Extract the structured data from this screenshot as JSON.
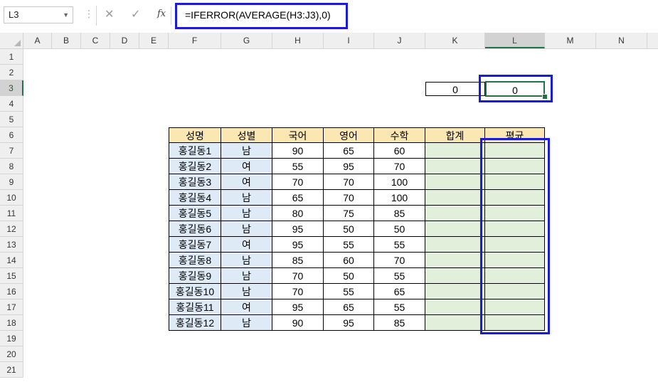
{
  "formula_bar": {
    "name_box": "L3",
    "cancel_glyph": "✕",
    "enter_glyph": "✓",
    "fx_label": "fx",
    "formula": "=IFERROR(AVERAGE(H3:J3),0)"
  },
  "columns": [
    "A",
    "B",
    "C",
    "D",
    "E",
    "F",
    "G",
    "H",
    "I",
    "J",
    "K",
    "L",
    "M",
    "N"
  ],
  "rows": [
    "1",
    "2",
    "3",
    "4",
    "5",
    "6",
    "7",
    "8",
    "9",
    "10",
    "11",
    "12",
    "13",
    "14",
    "15",
    "16",
    "17",
    "18",
    "19",
    "20",
    "21"
  ],
  "selected_cell": {
    "column": "L",
    "row": "3"
  },
  "summary_cells": {
    "k3": "0",
    "l3": "0"
  },
  "table": {
    "headers": [
      "성명",
      "성별",
      "국어",
      "영어",
      "수학",
      "합계",
      "평균"
    ],
    "rows": [
      [
        "홍길동1",
        "남",
        "90",
        "65",
        "60",
        "",
        ""
      ],
      [
        "홍길동2",
        "여",
        "55",
        "95",
        "70",
        "",
        ""
      ],
      [
        "홍길동3",
        "여",
        "70",
        "70",
        "100",
        "",
        ""
      ],
      [
        "홍길동4",
        "남",
        "65",
        "70",
        "100",
        "",
        ""
      ],
      [
        "홍길동5",
        "남",
        "80",
        "75",
        "85",
        "",
        ""
      ],
      [
        "홍길동6",
        "남",
        "95",
        "50",
        "50",
        "",
        ""
      ],
      [
        "홍길동7",
        "여",
        "95",
        "55",
        "55",
        "",
        ""
      ],
      [
        "홍길동8",
        "남",
        "85",
        "60",
        "70",
        "",
        ""
      ],
      [
        "홍길동9",
        "남",
        "70",
        "50",
        "55",
        "",
        ""
      ],
      [
        "홍길동10",
        "남",
        "70",
        "55",
        "65",
        "",
        ""
      ],
      [
        "홍길동11",
        "여",
        "95",
        "65",
        "55",
        "",
        ""
      ],
      [
        "홍길동12",
        "남",
        "90",
        "95",
        "85",
        "",
        ""
      ]
    ]
  },
  "colors": {
    "header_fill": "#fbe7b2",
    "name_fill": "#deeaf6",
    "result_fill": "#e2efda",
    "highlight_box": "#1a1adb",
    "selection": "#217346"
  }
}
